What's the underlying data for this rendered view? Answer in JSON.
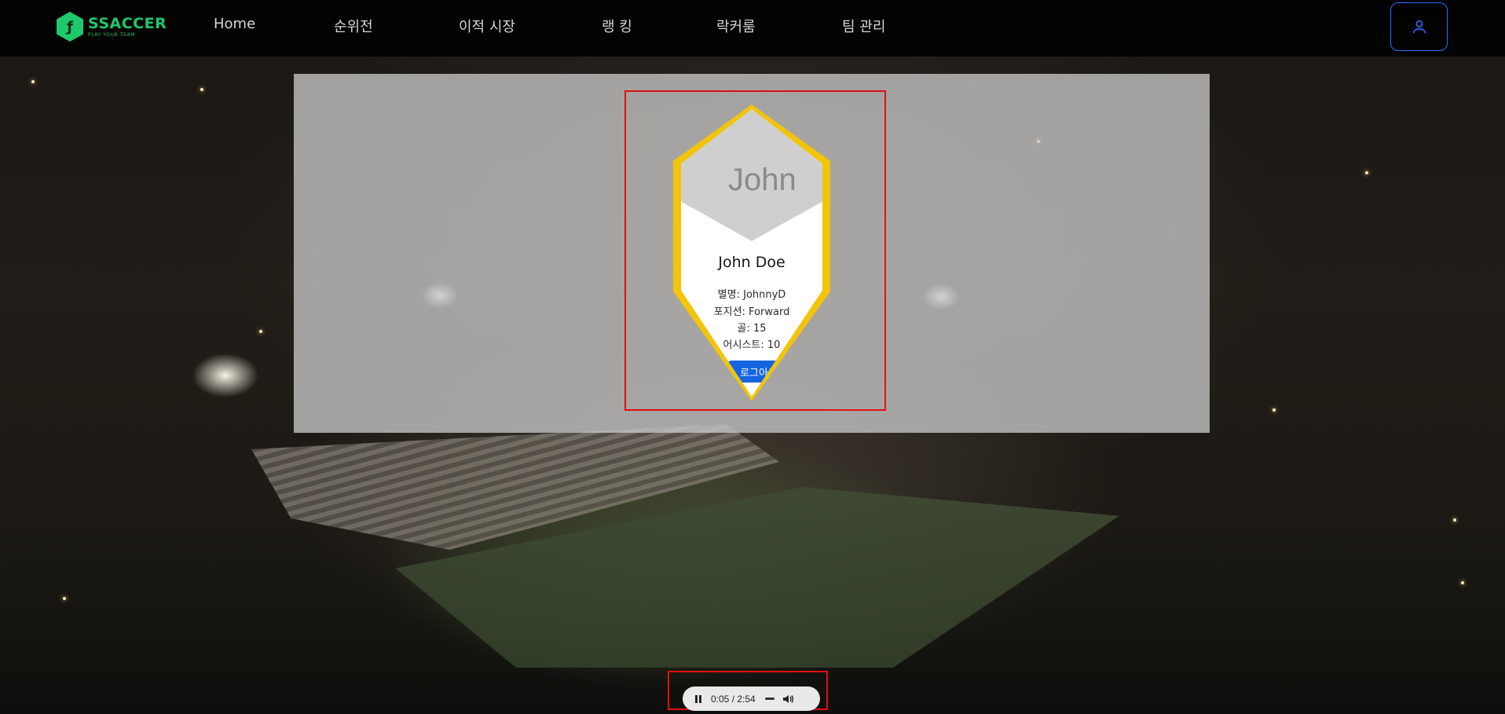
{
  "brand": {
    "name": "SSACCER",
    "slogan": "PLAY YOUR TEAM",
    "color": "#1ec86b"
  },
  "nav": {
    "items": [
      {
        "label": "Home"
      },
      {
        "label": "순위전"
      },
      {
        "label": "이적 시장"
      },
      {
        "label": "랭 킹"
      },
      {
        "label": "락커룸"
      },
      {
        "label": "팀 관리"
      }
    ],
    "user_icon": "user-icon"
  },
  "profile": {
    "photo_placeholder": "John",
    "name": "John Doe",
    "nickname": "별명: JohnnyD",
    "position": "포지션: Forward",
    "goals": "골: 15",
    "assists": "어시스트: 10",
    "logout_label": "로그아웃",
    "accent_color": "#f2c40a",
    "button_color": "#1565e0"
  },
  "player": {
    "time": "0:05 / 2:54",
    "state_icon": "pause-icon",
    "volume_icon": "volume-icon"
  }
}
